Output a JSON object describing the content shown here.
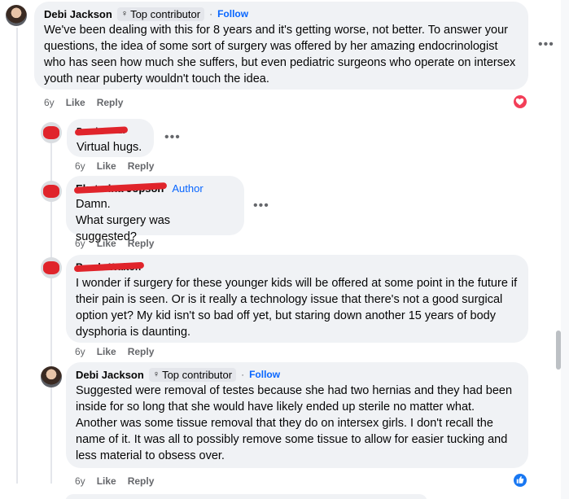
{
  "comments": [
    {
      "author": "Debi Jackson",
      "badge": "Top contributor",
      "follow": "Follow",
      "text": "We've been dealing with this for 8 years and it's getting worse, not better. To answer your questions, the idea of some sort of surgery was offered by her amazing endocrinologist who has seen how much she suffers, but even pediatric surgeons who operate on intersex youth near puberty wouldn't touch the idea.",
      "time": "6y",
      "like": "Like",
      "reply": "Reply",
      "reaction": "love"
    },
    {
      "author": "Brook Nolan",
      "text": "Virtual hugs.",
      "time": "6y",
      "like": "Like",
      "reply": "Reply"
    },
    {
      "author": "Ekaterina Jopson",
      "author_tag": "Author",
      "text_lines": [
        "Damn.",
        "What surgery was suggested?"
      ],
      "time": "6y",
      "like": "Like",
      "reply": "Reply"
    },
    {
      "author": "Ronda Walton",
      "text": "I wonder if surgery for these younger kids will be offered at some point in the future if their pain is seen. Or is it really a technology issue that there's not a good surgical option yet? My kid isn't so bad off yet, but staring down another 15 years of body dysphoria is daunting.",
      "time": "6y",
      "like": "Like",
      "reply": "Reply"
    },
    {
      "author": "Debi Jackson",
      "badge": "Top contributor",
      "follow": "Follow",
      "text": "Suggested were removal of testes because she had two hernias and they had been inside for so long that she would have likely ended up sterile no matter what. Another was some tissue removal that they do on intersex girls. I don't recall the name of it. It was all to possibly remove some tissue to allow for easier tucking and less material to obsess over.",
      "time": "6y",
      "like": "Like",
      "reply": "Reply",
      "reaction": "like"
    }
  ],
  "separator_dot": "·",
  "more_glyph": "•••",
  "colors": {
    "accent": "#0866ff",
    "bubble": "#f0f2f5",
    "love": "#f33e58",
    "like": "#1877f2",
    "redaction": "#e0242b"
  }
}
